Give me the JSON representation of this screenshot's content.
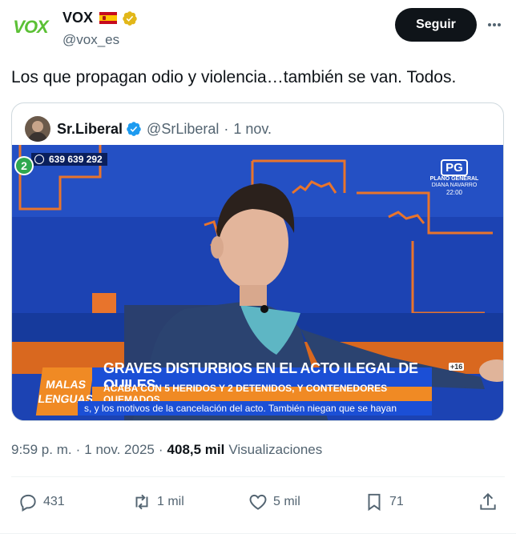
{
  "tweet": {
    "author": {
      "avatar_text": "VOX",
      "display_name": "VOX",
      "handle": "@vox_es",
      "flag_icon": "spain-flag-icon",
      "verified_icon": "verified-gold-icon"
    },
    "follow_label": "Seguir",
    "text": "Los que propagan odio y violencia…también se van. Todos."
  },
  "quote": {
    "display_name": "Sr.Liberal",
    "handle": "@SrLiberal",
    "separator": "·",
    "date": "1 nov.",
    "media": {
      "phone": "639 639 292",
      "rating": {
        "badge": "PG",
        "line1": "PLANO GENERAL",
        "line2": "DIANA NAVARRO",
        "time": "22:00"
      },
      "show_logo": [
        "MALAS",
        "LENGUAS"
      ],
      "headline": "GRAVES DISTURBIOS EN EL ACTO ILEGAL DE QUILES",
      "subheadline": "ACABA CON 5 HERIDOS Y 2 DETENIDOS, Y CONTENEDORES QUEMADOS",
      "ticker": "s, y los motivos de la cancelación del acto. También niegan que se hayan",
      "age_rating": "+16",
      "channel": "2"
    }
  },
  "meta": {
    "time": "9:59 p. m.",
    "separator": "·",
    "date": "1 nov. 2025",
    "separator2": "·",
    "views_count": "408,5 mil",
    "views_label": "Visualizaciones"
  },
  "actions": {
    "replies": "431",
    "reposts": "1 mil",
    "likes": "5 mil",
    "bookmarks": "71"
  },
  "colors": {
    "accent": "#1d9bf0",
    "text": "#0f1419",
    "muted": "#536471",
    "vox_green": "#5bc035",
    "tv_blue": "#1b4fd6",
    "tv_orange": "#f08a24"
  }
}
